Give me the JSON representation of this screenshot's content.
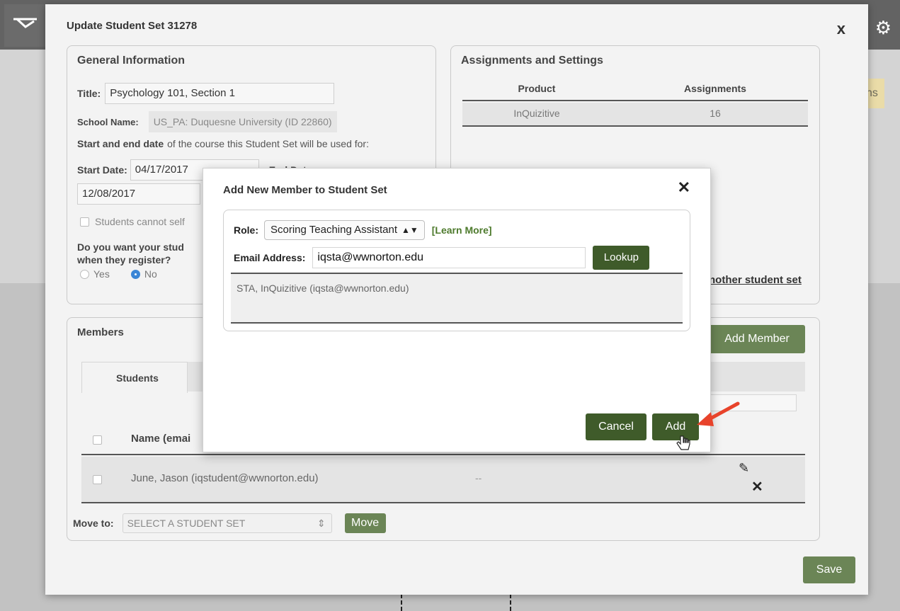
{
  "background": {
    "yellow_badge_text": "ns"
  },
  "modal": {
    "title": "Update Student Set 31278",
    "close_label": "x"
  },
  "general": {
    "heading": "General Information",
    "title_label": "Title:",
    "title_value": "Psychology 101, Section 1",
    "school_label": "School Name:",
    "school_value": "US_PA: Duquesne University (ID 22860)",
    "dates_bold": "Start and end date",
    "dates_rest": "of the course this Student Set will be used for:",
    "start_label": "Start Date:",
    "start_value": "04/17/2017",
    "end_label": "End Date:",
    "end_value": "12/08/2017",
    "self_checkbox_label": "Students cannot self",
    "question_line1": "Do you want your stud",
    "question_line2": "when they register?",
    "yes_label": "Yes",
    "no_label": "No"
  },
  "assignments": {
    "heading": "Assignments and Settings",
    "col_product": "Product",
    "col_assignments": "Assignments",
    "rows": [
      {
        "product": "InQuizitive",
        "assignments": "16"
      }
    ],
    "link_text": "nother student set"
  },
  "members": {
    "heading": "Members",
    "add_member_label": "Add Member",
    "tab_students": "Students",
    "col_name": "Name (emai",
    "rows": [
      {
        "name": "June, Jason (iqstudent@wwnorton.edu)",
        "value": "--"
      }
    ],
    "move_to_label": "Move to:",
    "move_select_value": "SELECT A STUDENT SET",
    "move_button": "Move"
  },
  "save_label": "Save",
  "dialog": {
    "title": "Add New Member to Student Set",
    "close_label": "✕",
    "role_label": "Role:",
    "role_value": "Scoring Teaching Assistant",
    "learn_more": "[Learn More]",
    "email_label": "Email Address:",
    "email_value": "iqsta@wwnorton.edu",
    "lookup_label": "Lookup",
    "result_text": "STA,  InQuizitive  (iqsta@wwnorton.edu)",
    "cancel_label": "Cancel",
    "add_label": "Add"
  },
  "colors": {
    "green_button": "#6b8556",
    "dark_green_button": "#3f5b2a",
    "learn_more": "#4d7a2c",
    "arrow": "#e8432b"
  }
}
